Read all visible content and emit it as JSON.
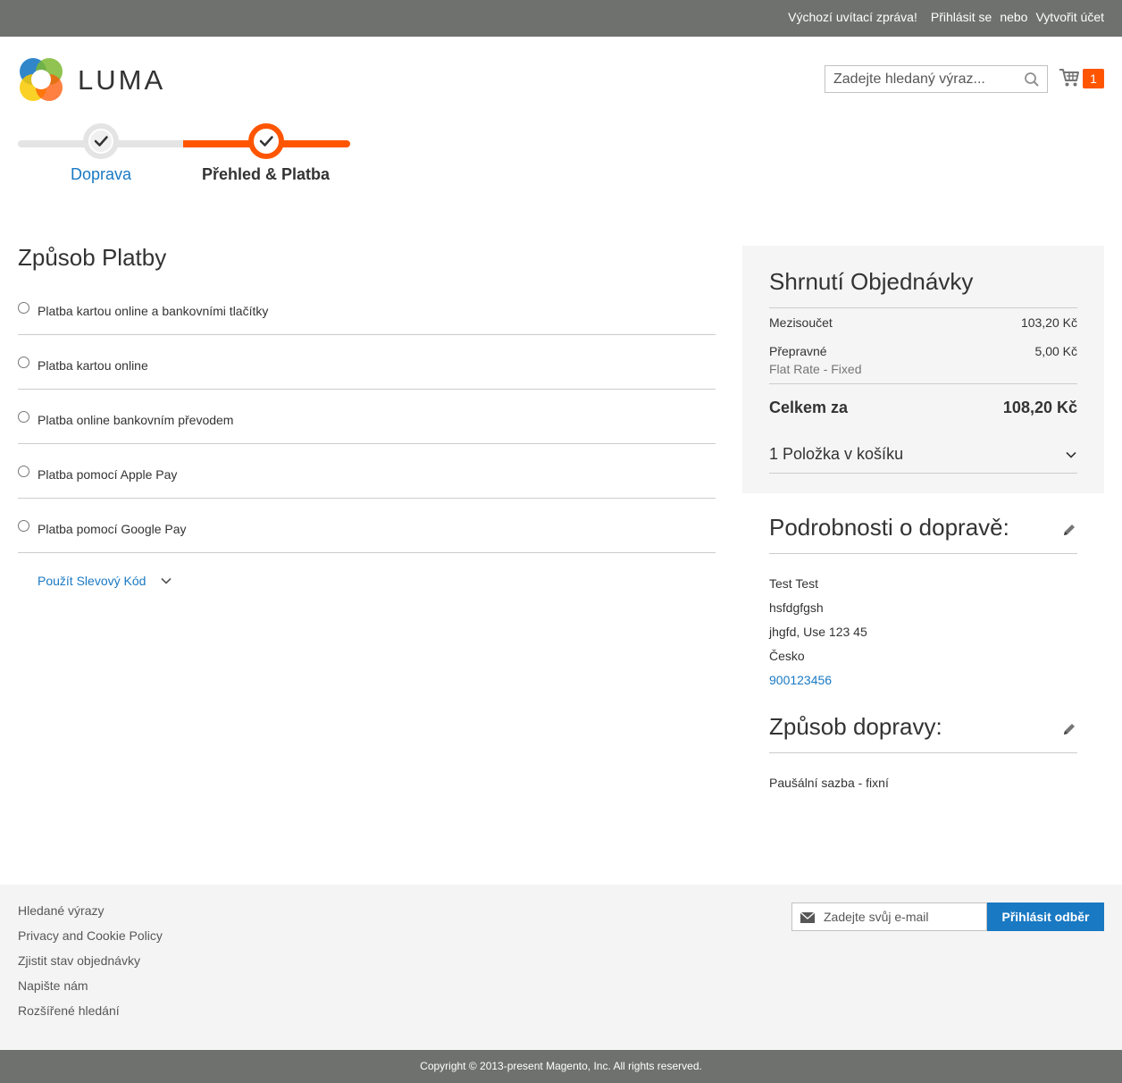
{
  "header": {
    "welcome": "Výchozí uvítací zpráva!",
    "sign_in": "Přihlásit se",
    "separator": "nebo",
    "create_account": "Vytvořit účet"
  },
  "logo": {
    "text": "LUMA"
  },
  "search": {
    "placeholder": "Zadejte hledaný výraz..."
  },
  "cart": {
    "count": "1"
  },
  "progress": {
    "steps": [
      {
        "label": "Doprava",
        "state": "done"
      },
      {
        "label": "Přehled & Platba",
        "state": "current"
      }
    ]
  },
  "payment": {
    "title": "Způsob Platby",
    "methods": [
      "Platba kartou online a bankovními tlačítky",
      "Platba kartou online",
      "Platba online bankovním převodem",
      "Platba pomocí Apple Pay",
      "Platba pomocí Google Pay"
    ],
    "discount_label": "Použít Slevový Kód"
  },
  "summary": {
    "title": "Shrnutí Objednávky",
    "subtotal_label": "Mezisoučet",
    "subtotal_value": "103,20 Kč",
    "shipping_label": "Přepravné",
    "shipping_value": "5,00 Kč",
    "shipping_method": "Flat Rate - Fixed",
    "total_label": "Celkem za",
    "total_value": "108,20 Kč",
    "items_label": "1 Položka v košíku"
  },
  "ship_to": {
    "title": "Podrobnosti o dopravě:",
    "lines": [
      "Test Test",
      "hsfdgfgsh",
      "jhgfd, Use 123 45",
      "Česko"
    ],
    "phone": "900123456"
  },
  "ship_method": {
    "title": "Způsob dopravy:",
    "value": "Paušální sazba - fixní"
  },
  "footer": {
    "links": [
      "Hledané výrazy",
      "Privacy and Cookie Policy",
      "Zjistit stav objednávky",
      "Napište nám",
      "Rozšířené hledání"
    ],
    "newsletter_placeholder": "Zadejte svůj e-mail",
    "newsletter_button": "Přihlásit odběr",
    "copyright": "Copyright © 2013-present Magento, Inc. All rights reserved."
  },
  "colors": {
    "accent": "#ff5501",
    "link": "#1979c3",
    "topbar": "#6e716e",
    "summary_bg": "#f5f5f5",
    "footer_bg": "#f4f4f4"
  }
}
